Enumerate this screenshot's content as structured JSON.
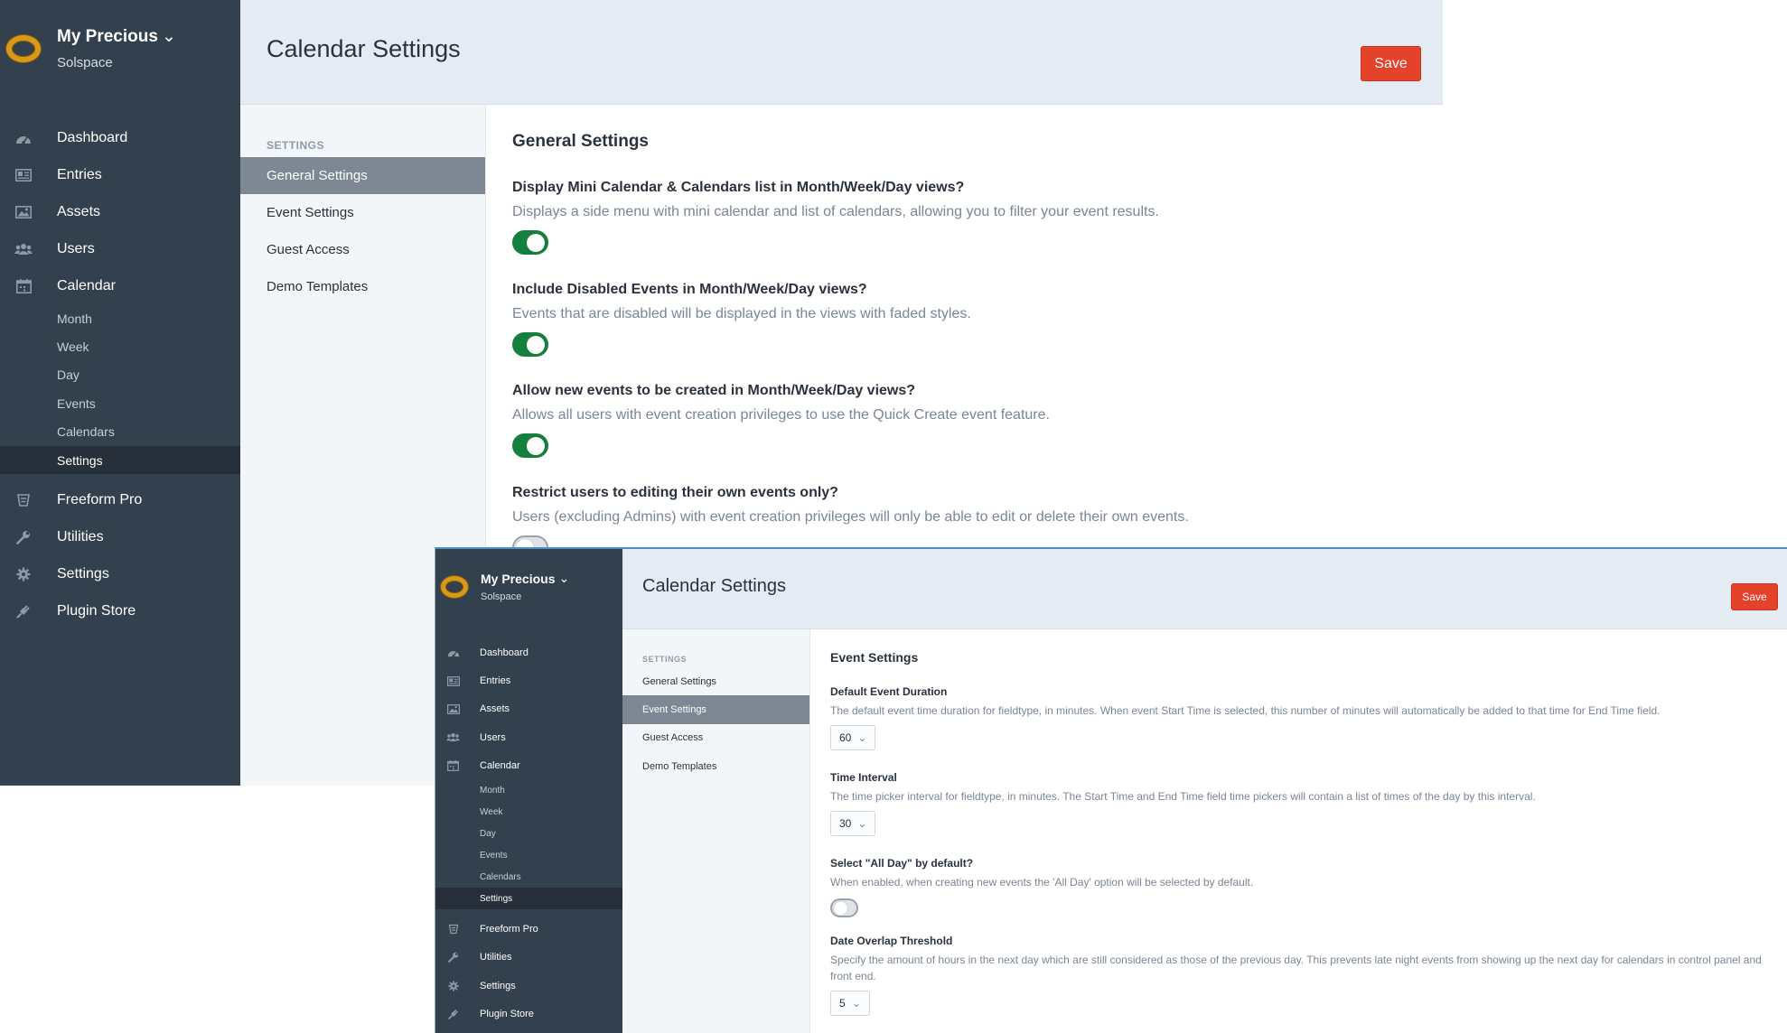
{
  "back_window": {
    "brand": {
      "site_name": "My Precious",
      "site_chevron": "⌄",
      "org_name": "Solspace",
      "logo_icon": "ring-icon"
    },
    "nav": {
      "dashboard": "Dashboard",
      "entries": "Entries",
      "assets": "Assets",
      "users": "Users",
      "calendar": "Calendar",
      "calendar_sub": {
        "month": "Month",
        "week": "Week",
        "day": "Day",
        "events": "Events",
        "calendars": "Calendars",
        "settings": "Settings"
      },
      "freeform": "Freeform Pro",
      "utilities": "Utilities",
      "settings": "Settings",
      "plugin_store": "Plugin Store"
    },
    "header": {
      "title": "Calendar Settings",
      "save_label": "Save"
    },
    "subnav": {
      "heading": "SETTINGS",
      "general": "General Settings",
      "event": "Event Settings",
      "guest": "Guest Access",
      "demo": "Demo Templates",
      "active": "General Settings"
    },
    "section_title": "General Settings",
    "fields": {
      "mini_calendar": {
        "label": "Display Mini Calendar & Calendars list in Month/Week/Day views?",
        "desc": "Displays a side menu with mini calendar and list of calendars, allowing you to filter your event results.",
        "enabled": true
      },
      "disabled_events": {
        "label": "Include Disabled Events in Month/Week/Day views?",
        "desc": "Events that are disabled will be displayed in the views with faded styles.",
        "enabled": true
      },
      "quick_create": {
        "label": "Allow new events to be created in Month/Week/Day views?",
        "desc": "Allows all users with event creation privileges to use the Quick Create event feature.",
        "enabled": true
      },
      "restrict_users": {
        "label": "Restrict users to editing their own events only?",
        "desc": "Users (excluding Admins) with event creation privileges will only be able to edit or delete their own events.",
        "enabled": false
      }
    }
  },
  "front_window": {
    "brand": {
      "site_name": "My Precious",
      "site_chevron": "⌄",
      "org_name": "Solspace",
      "logo_icon": "ring-icon"
    },
    "nav": {
      "dashboard": "Dashboard",
      "entries": "Entries",
      "assets": "Assets",
      "users": "Users",
      "calendar": "Calendar",
      "calendar_sub": {
        "month": "Month",
        "week": "Week",
        "day": "Day",
        "events": "Events",
        "calendars": "Calendars",
        "settings": "Settings"
      },
      "freeform": "Freeform Pro",
      "utilities": "Utilities",
      "settings": "Settings",
      "plugin_store": "Plugin Store"
    },
    "header": {
      "title": "Calendar Settings",
      "save_label": "Save"
    },
    "subnav": {
      "heading": "SETTINGS",
      "general": "General Settings",
      "event": "Event Settings",
      "guest": "Guest Access",
      "demo": "Demo Templates",
      "active": "Event Settings"
    },
    "section_title": "Event Settings",
    "fields": {
      "duration": {
        "label": "Default Event Duration",
        "desc": "The default event time duration for fieldtype, in minutes. When event Start Time is selected, this number of minutes will automatically be added to that time for End Time field.",
        "value": "60"
      },
      "interval": {
        "label": "Time Interval",
        "desc": "The time picker interval for fieldtype, in minutes. The Start Time and End Time field time pickers will contain a list of times of the day by this interval.",
        "value": "30"
      },
      "all_day": {
        "label": "Select \"All Day\" by default?",
        "desc": "When enabled, when creating new events the 'All Day' option will be selected by default.",
        "enabled": false
      },
      "overlap": {
        "label": "Date Overlap Threshold",
        "desc": "Specify the amount of hours in the next day which are still considered as those of the previous day. This prevents late night events from showing up the next day for calendars in control panel and front end.",
        "value": "5"
      }
    },
    "select_caret": "⌄"
  },
  "colors": {
    "sidebar": "#33404d",
    "header": "#e4ebf3",
    "save": "#e5422b",
    "toggle_on": "#15803d",
    "subnav_active": "#7d8894"
  },
  "icons": [
    "dashboard-icon",
    "entries-icon",
    "assets-icon",
    "users-icon",
    "calendar-icon",
    "freeform-icon",
    "wrench-icon",
    "gear-icon",
    "plug-icon"
  ]
}
